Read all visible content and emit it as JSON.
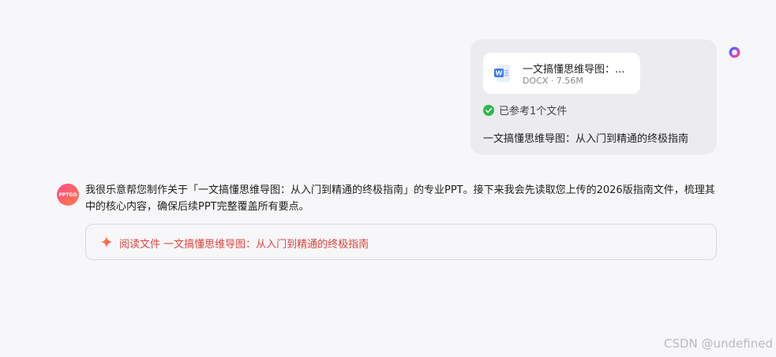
{
  "user_message": {
    "attachment": {
      "file_name": "一文搞懂思维导图：...",
      "file_meta": "DOCX · 7.56M",
      "icon": "word-document-icon"
    },
    "reference_status": "已参考1个文件",
    "text": "一文搞懂思维导图：从入门到精通的终极指南"
  },
  "assistant_message": {
    "avatar_label": "PPTGO",
    "text": "我很乐意帮您制作关于「一文搞懂思维导图：从入门到精通的终极指南」的专业PPT。接下来我会先读取您上传的2026版指南文件，梳理其中的核心内容，确保后续PPT完整覆盖所有要点。",
    "action_card": {
      "label": "阅读文件 一文搞懂思维导图：从入门到精通的终极指南",
      "icon": "sparkle-icon"
    }
  },
  "watermark": "CSDN @undefined",
  "colors": {
    "accent_red": "#e0443e",
    "check_green": "#2eb84b",
    "bubble_bg": "#ececf0"
  }
}
